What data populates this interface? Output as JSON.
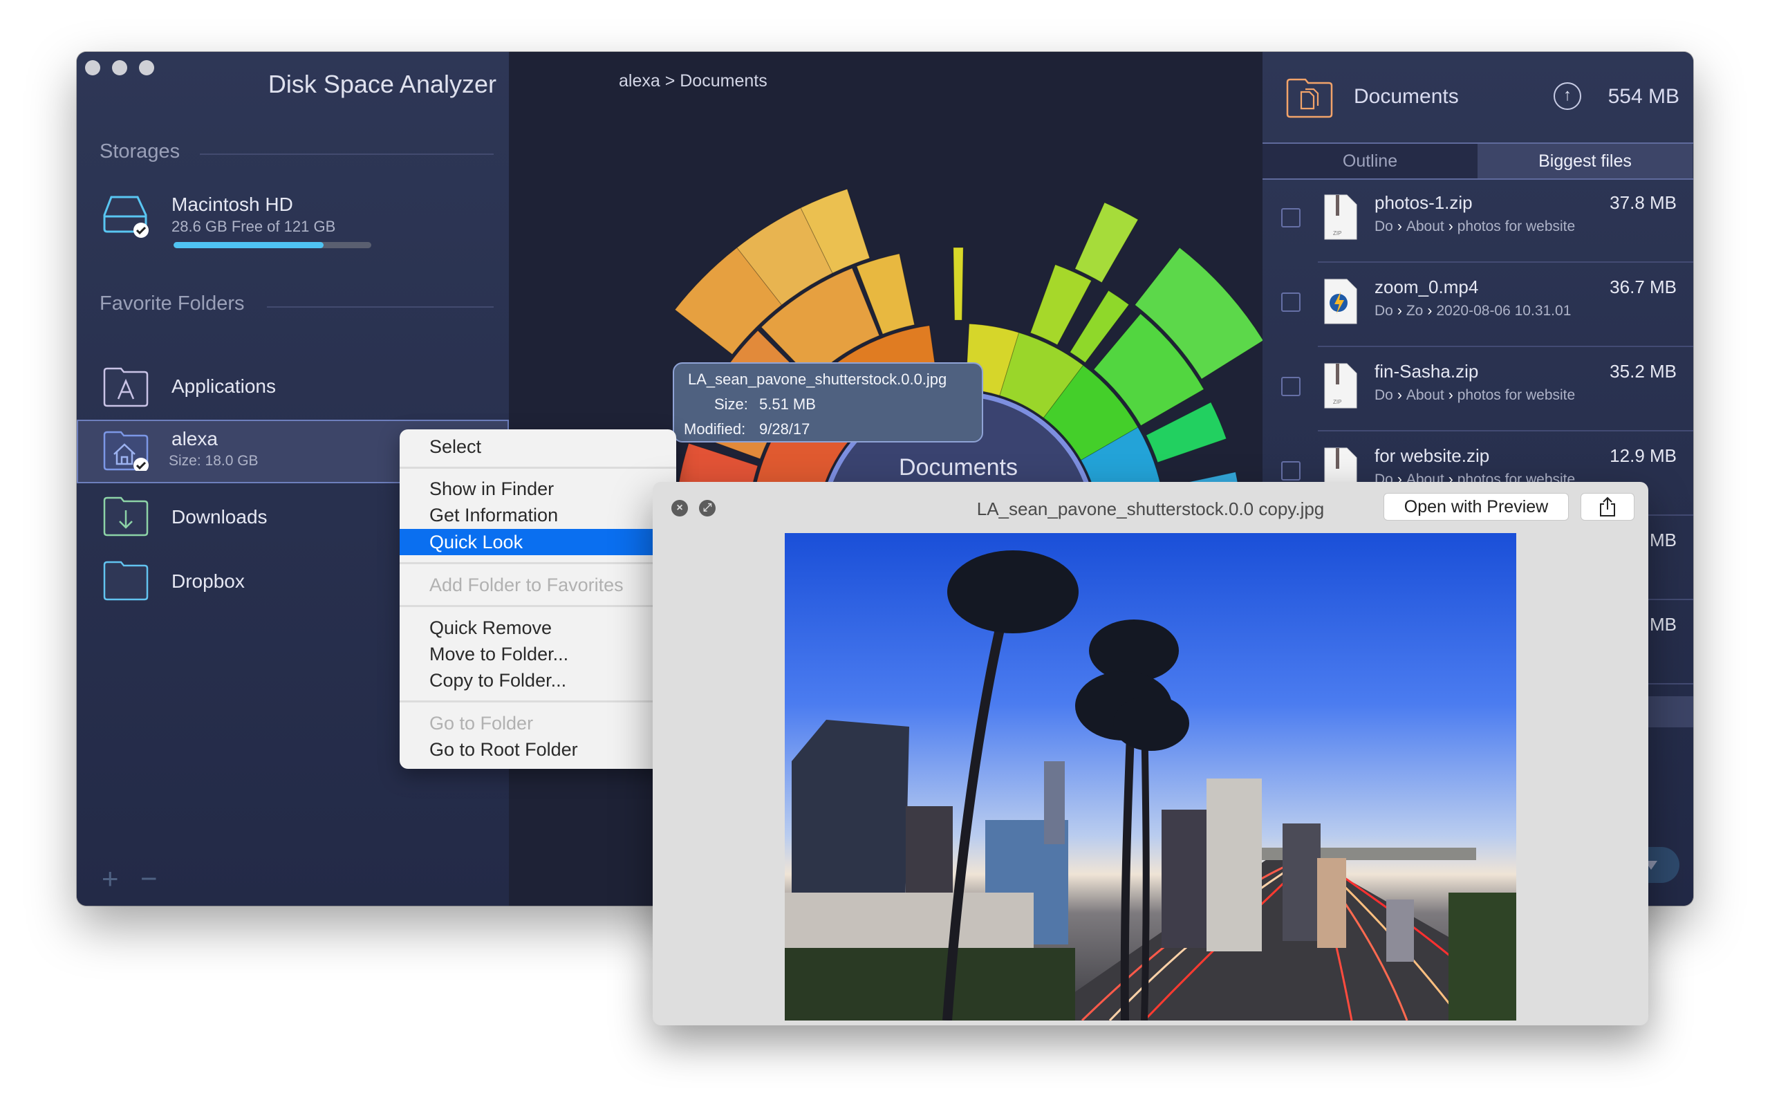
{
  "app": {
    "title": "Disk Space Analyzer",
    "window_controls": [
      "close",
      "minimize",
      "zoom"
    ]
  },
  "sidebar": {
    "storages_label": "Storages",
    "storage": {
      "name": "Macintosh HD",
      "subtitle": "28.6 GB Free of 121 GB",
      "used_fraction": 0.76,
      "icon": "hard-drive-icon"
    },
    "favorites_label": "Favorite Folders",
    "favorites": [
      {
        "label": "Applications",
        "icon": "applications-folder-icon"
      },
      {
        "label": "alexa",
        "subtitle": "Size: 18.0 GB",
        "icon": "home-folder-icon",
        "selected": true
      },
      {
        "label": "Downloads",
        "icon": "downloads-folder-icon"
      },
      {
        "label": "Dropbox",
        "icon": "dropbox-folder-icon"
      }
    ],
    "add_label": "+",
    "remove_label": "−"
  },
  "center": {
    "breadcrumb": "alexa > Documents",
    "center_label": "Documents",
    "tooltip": {
      "name": "LA_sean_pavone_shutterstock.0.0.jpg",
      "size_label": "Size:",
      "size_value": "5.51 MB",
      "modified_label": "Modified:",
      "modified_value": "9/28/17"
    }
  },
  "right_panel": {
    "title": "Documents",
    "size": "554 MB",
    "up_icon": "↑",
    "tabs": [
      {
        "label": "Outline",
        "active": false
      },
      {
        "label": "Biggest files",
        "active": true
      }
    ],
    "files": [
      {
        "name": "photos-1.zip",
        "size": "37.8 MB",
        "path": [
          "Do",
          "About",
          "photos for website"
        ],
        "icon": "zip-file-icon"
      },
      {
        "name": "zoom_0.mp4",
        "size": "36.7 MB",
        "path": [
          "Do",
          "Zo",
          "2020-08-06 10.31.01"
        ],
        "icon": "video-file-icon"
      },
      {
        "name": "fin-Sasha.zip",
        "size": "35.2 MB",
        "path": [
          "Do",
          "About",
          "photos for website"
        ],
        "icon": "zip-file-icon"
      },
      {
        "name": "for website.zip",
        "size": "12.9 MB",
        "path": [
          "Do",
          "About",
          "photos for website"
        ],
        "icon": "zip-file-icon"
      },
      {
        "name": "",
        "size": "MB",
        "path": [],
        "icon": "file-icon"
      },
      {
        "name": "",
        "size": "MB",
        "path": [],
        "icon": "file-icon"
      }
    ]
  },
  "context_menu": {
    "items": [
      {
        "label": "Select",
        "state": "normal"
      },
      {
        "label": "Show in Finder",
        "state": "normal"
      },
      {
        "label": "Get Information",
        "state": "normal"
      },
      {
        "label": "Quick Look",
        "state": "highlighted"
      },
      {
        "label": "Add Folder to Favorites",
        "state": "disabled"
      },
      {
        "label": "Quick Remove",
        "state": "normal"
      },
      {
        "label": "Move to Folder...",
        "state": "normal"
      },
      {
        "label": "Copy to Folder...",
        "state": "normal"
      },
      {
        "label": "Go to Folder",
        "state": "disabled"
      },
      {
        "label": "Go to Root Folder",
        "state": "normal"
      }
    ]
  },
  "quicklook": {
    "title": "LA_sean_pavone_shutterstock.0.0 copy.jpg",
    "open_button": "Open with Preview",
    "share_icon": "share-icon",
    "image_description": "Los Angeles downtown skyline with palm trees and freeway light trails at dusk"
  },
  "colors": {
    "sidebar_bg": "#2e3756",
    "center_bg": "#1e2236",
    "accent_blue": "#4fc3f2",
    "menu_highlight": "#0a6ff0",
    "tooltip_bg": "#4f6180"
  }
}
